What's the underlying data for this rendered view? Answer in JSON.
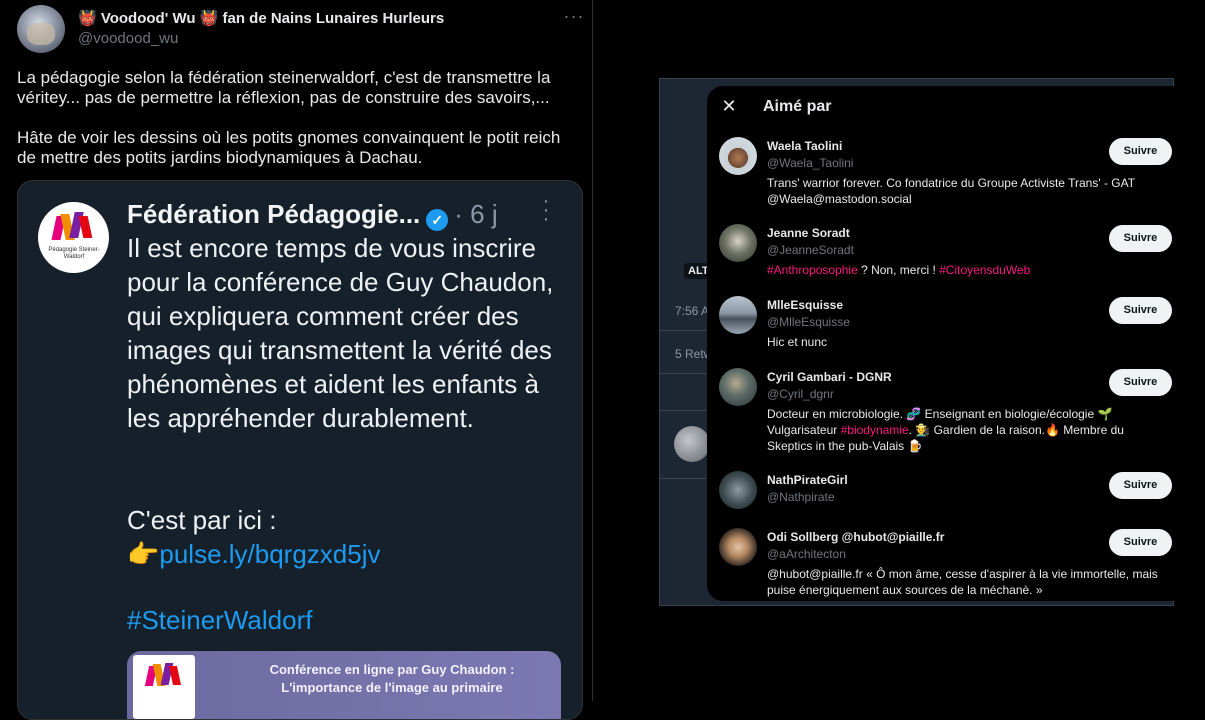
{
  "tweet": {
    "author_name": "👹 Voodood' Wu 👹 fan de Nains Lunaires Hurleurs",
    "author_handle": "@voodood_wu",
    "more_icon": "more-horizontal-icon",
    "text": "La pédagogie selon la fédération steinerwaldorf, c'est de transmettre la véritey... pas de permettre la réflexion, pas de construire des savoirs,...\n\nHâte de voir les dessins où les potits gnomes convainquent le potit reich de mettre des potits jardins biodynamiques à Dachau."
  },
  "embedded": {
    "name": "Fédération Pédagogie...",
    "age": "· 6 j",
    "logo_text": "Pédagogie Steiner-Waldorf",
    "body": "Il est encore temps de vous inscrire pour la conférence de Guy Chaudon, qui expliquera comment créer des images qui transmettent la vérité des phénomènes et aident les enfants à les appréhender durablement.",
    "cta": "C'est par ici :",
    "link_emoji": "👉",
    "link": "pulse.ly/bqrgzxd5jv",
    "hashtag": "#SteinerWaldorf",
    "card_title": "Conférence en ligne par Guy Chaudon : L'importance de l'image au primaire"
  },
  "background": {
    "alt_badge": "ALT",
    "time": "7:56 A",
    "retweets": "5 Retw"
  },
  "modal": {
    "title": "Aimé par",
    "close_icon": "close-icon",
    "follow_label": "Suivre",
    "users": [
      {
        "name": "Waela Taolini",
        "handle": "@Waela_Taolini",
        "bio": [
          "Trans' warrior forever. Co fondatrice du Groupe Activiste Trans' - GAT ",
          "@Waela@mastodon.social"
        ]
      },
      {
        "name": "Jeanne Soradt",
        "handle": "@JeanneSoradt",
        "bio_tag1": "#Anthroposophie",
        "bio_mid": " ? Non, merci ! ",
        "bio_tag2": "#CitoyensduWeb"
      },
      {
        "name": "MlleEsquisse",
        "handle": "@MlleEsquisse",
        "bio": [
          "Hic et nunc"
        ]
      },
      {
        "name": "Cyril Gambari - DGNR",
        "handle": "@Cyril_dgnr",
        "bio_a": "Docteur en microbiologie. 🧬 Enseignant en biologie/écologie 🌱 Vulgarisateur ",
        "bio_tag": "#biodynamie",
        "bio_b": ". 🧑‍🌾 Gardien de la raison.🔥 Membre du Skeptics in the pub-Valais 🍺"
      },
      {
        "name": "NathPirateGirl",
        "handle": "@Nathpirate",
        "bio": []
      },
      {
        "name": "Odi Sollberg @hubot@piaille.fr",
        "handle": "@aArchitecton",
        "bio": [
          "@hubot@piaille.fr « Ô mon âme, cesse d'aspirer à la vie immortelle, mais puise énergiquement aux sources de la méchanè. »"
        ]
      }
    ]
  }
}
